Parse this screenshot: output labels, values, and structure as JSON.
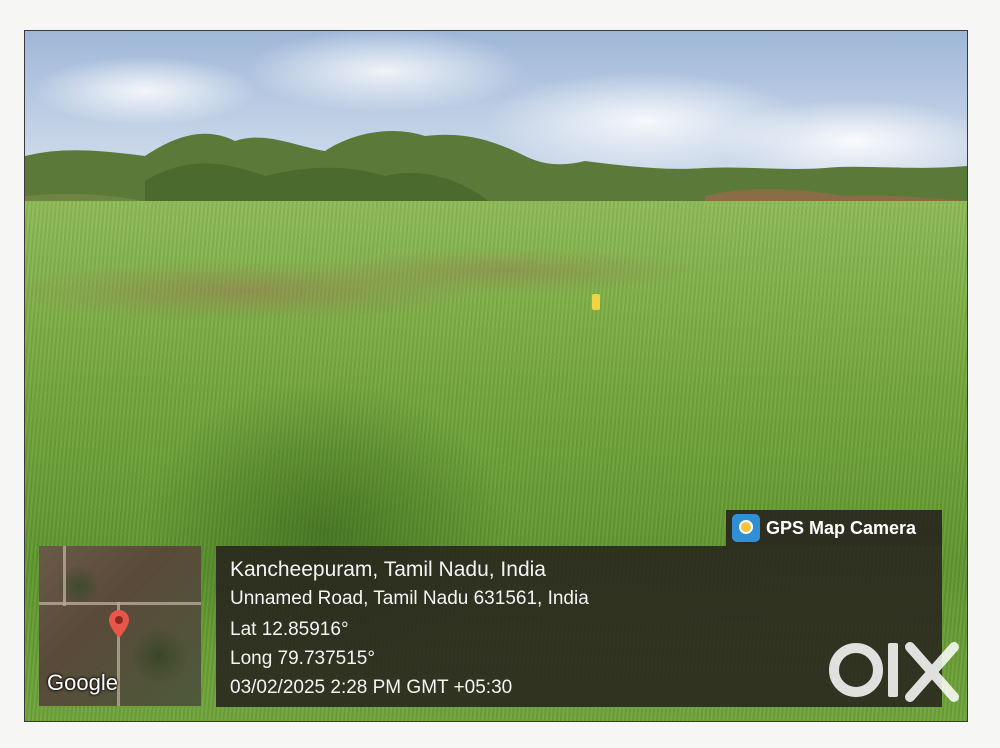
{
  "overlay": {
    "map_label": "Google",
    "app_badge": "GPS Map Camera",
    "location_line": "Kancheepuram, Tamil Nadu, India",
    "address_line": "Unnamed Road, Tamil Nadu 631561, India",
    "latitude": "Lat 12.85916°",
    "longitude": "Long 79.737515°",
    "datetime": "03/02/2025 2:28 PM GMT +05:30"
  },
  "watermark": {
    "logo_text": "OLX"
  },
  "icons": {
    "map_pin": "map-pin-icon",
    "app_icon": "gps-camera-icon"
  },
  "colors": {
    "pin": "#e8564a",
    "panel_bg": "#28241e",
    "sky": "#9fb7d8",
    "grass": "#6fa23a"
  }
}
